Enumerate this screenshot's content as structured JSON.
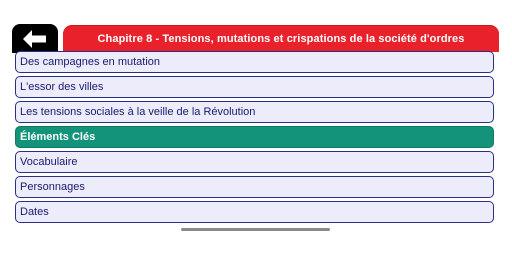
{
  "header": {
    "title": "Chapitre 8 - Tensions, mutations et crispations de la société d'ordres",
    "back_icon": "arrow-left-icon",
    "title_bg": "#e8212b",
    "back_bg": "#000000"
  },
  "list": {
    "items": [
      {
        "label": "Des campagnes en mutation",
        "selected": false
      },
      {
        "label": "L'essor des villes",
        "selected": false
      },
      {
        "label": "Les tensions sociales à la veille de la Révolution",
        "selected": false
      },
      {
        "label": "Éléments Clés",
        "selected": true
      },
      {
        "label": "Vocabulaire",
        "selected": false
      },
      {
        "label": "Personnages",
        "selected": false
      },
      {
        "label": "Dates",
        "selected": false
      }
    ],
    "item_bg": "#ececfa",
    "item_border": "#2a2f86",
    "selected_bg": "#13947a"
  }
}
